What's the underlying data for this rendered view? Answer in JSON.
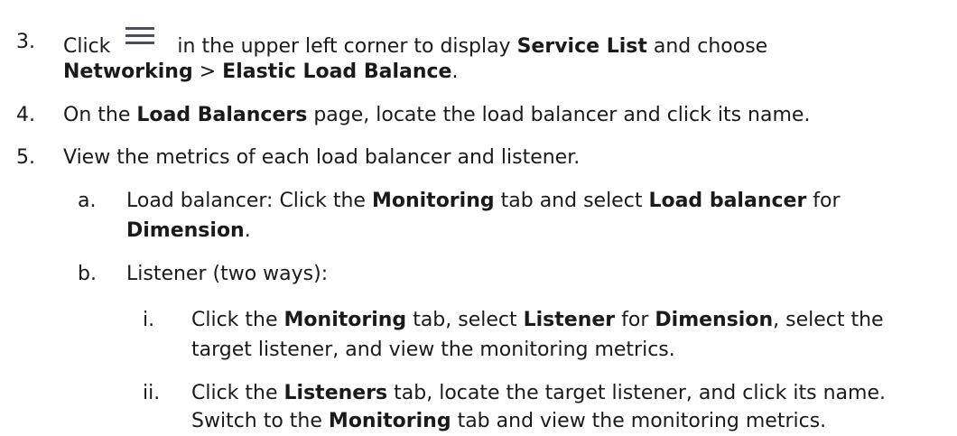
{
  "steps": [
    {
      "num": "3.",
      "click": "Click",
      "t1": "in the upper left corner to display",
      "b1": "Service List",
      "t2": "and choose",
      "b2": "Networking",
      "t3": ">",
      "b3": "Elastic Load Balance",
      "t4": "."
    },
    {
      "num": "4.",
      "t1": "On the",
      "b1": "Load Balancers",
      "t2": "page, locate the load balancer and click its name."
    },
    {
      "num": "5.",
      "t1": "View the metrics of each load balancer and listener."
    }
  ],
  "sub": {
    "a": {
      "num": "a.",
      "t1": "Load balancer: Click the",
      "b1": "Monitoring",
      "t2": "tab and select",
      "b2": "Load balancer",
      "t3": "for",
      "b3": "Dimension",
      "t4": "."
    },
    "b": {
      "num": "b.",
      "t1": "Listener (two ways):"
    }
  },
  "subsub": {
    "i": {
      "num": "i.",
      "t1": "Click the",
      "b1": "Monitoring",
      "t2": "tab, select",
      "b2": "Listener",
      "t3": "for",
      "b3": "Dimension",
      "t4": ", select the",
      "t5": "target listener, and view the monitoring metrics."
    },
    "ii": {
      "num": "ii.",
      "t1": "Click the",
      "b1": "Listeners",
      "t2": "tab, locate the target listener, and click its name.",
      "t3": "Switch to the",
      "b2": "Monitoring",
      "t4": "tab and view the monitoring metrics."
    }
  }
}
